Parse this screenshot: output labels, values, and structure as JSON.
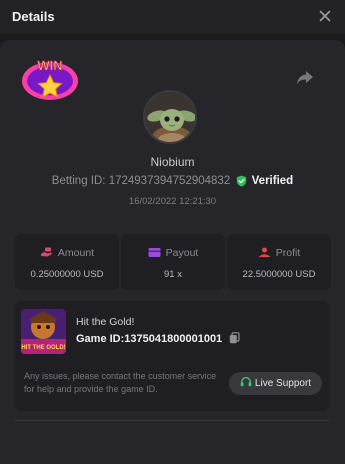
{
  "header": {
    "title": "Details"
  },
  "bet": {
    "username": "Niobium",
    "betting_id_label": "Betting ID:",
    "betting_id": "1724937394752904832",
    "verified_label": "Verified",
    "datetime": "16/02/2022 12:21:30"
  },
  "stats": [
    {
      "label": "Amount",
      "value": "0.25000000 USD",
      "color": "#e0476b"
    },
    {
      "label": "Payout",
      "value": "91 x",
      "color": "#9b4be0"
    },
    {
      "label": "Profit",
      "value": "22.5000000 USD",
      "color": "#e04a4a"
    }
  ],
  "game": {
    "name": "Hit the Gold!",
    "id_label": "Game ID:",
    "id": "1375041800001001",
    "thumb_text": "HIT THE GOLD!",
    "help_text": "Any issues, please contact the customer service for help and provide the game ID.",
    "support_label": "Live Support"
  },
  "badge": {
    "text": "WIN"
  },
  "colors": {
    "verified": "#2fbf5b",
    "support_icon": "#39c86a"
  }
}
